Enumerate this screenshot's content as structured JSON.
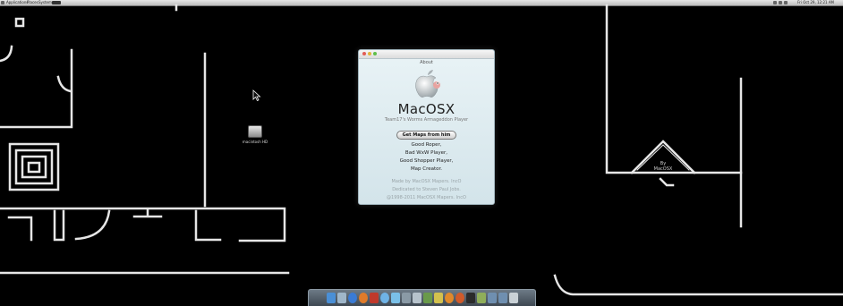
{
  "menubar": {
    "items": [
      "Applications",
      "Places",
      "System"
    ],
    "clock": "Fri Oct 29, 12:21 AM"
  },
  "desktop": {
    "hd_label": "macintosh HD"
  },
  "about_window": {
    "title": "About",
    "app_name": "MacOSX",
    "subtitle": "Team17's Worms Armageddon Player",
    "button_label": "Get Maps from him",
    "roles": [
      "Good Roper,",
      "Bad WxW Player,",
      "Good Shopper Player,",
      "Map Creator."
    ],
    "credits": [
      "Made by MacOSX Mapers. IncO",
      "Dedicated to Steven Paul Jobs.",
      "@1998-2011 MacOSX Mapers. IncO"
    ]
  },
  "map_sign": {
    "line1": "By",
    "line2": "MacOSX"
  },
  "colors": {
    "background": "#000000",
    "walls": "#e6e6e6",
    "window_bg": "#dbe9ee",
    "dock": "#55626d"
  },
  "dock": {
    "icons": [
      "finder-icon",
      "mail-icon",
      "safari-icon",
      "firefox-icon",
      "worms-icon",
      "ichat-icon",
      "itunes-icon",
      "iphoto-icon",
      "preview-icon",
      "textedit-icon",
      "terminal-icon",
      "vlc-icon",
      "adium-icon",
      "system-preferences-icon",
      "activity-icon",
      "folder-icon",
      "folder-icon",
      "trash-icon"
    ]
  }
}
